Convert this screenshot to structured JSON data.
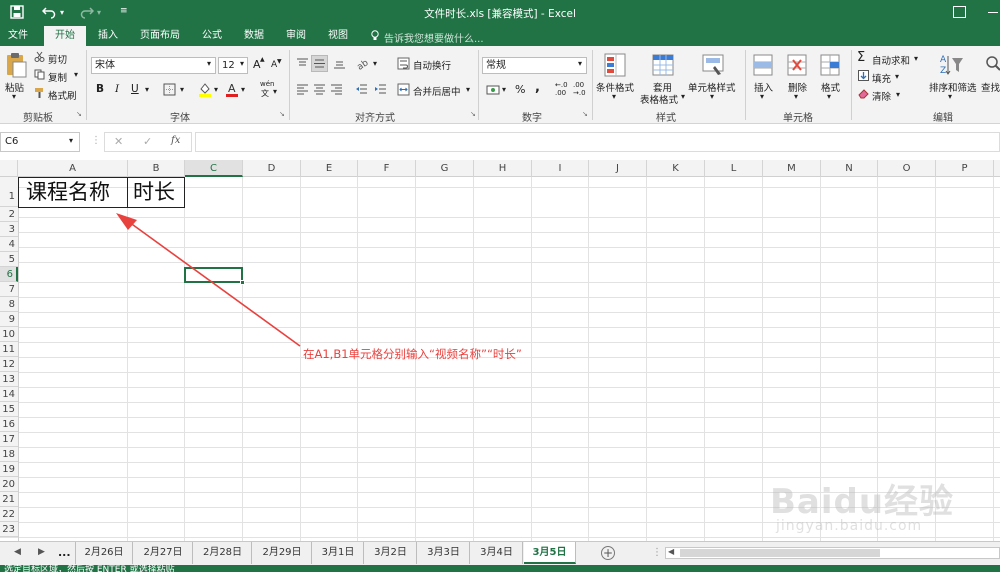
{
  "window": {
    "title": "文件时长.xls  [兼容模式] - Excel"
  },
  "tabs": [
    {
      "label": "文件"
    },
    {
      "label": "开始"
    },
    {
      "label": "插入"
    },
    {
      "label": "页面布局"
    },
    {
      "label": "公式"
    },
    {
      "label": "数据"
    },
    {
      "label": "审阅"
    },
    {
      "label": "视图"
    }
  ],
  "tell_me": "告诉我您想要做什么...",
  "ribbon": {
    "paste": "粘贴",
    "cut": "剪切",
    "copy": "复制",
    "format_painter": "格式刷",
    "clipboard_group": "剪贴板",
    "font_name": "宋体",
    "font_size": "12",
    "bold": "B",
    "italic": "I",
    "underline": "U",
    "font_group": "字体",
    "wrap_text": "自动换行",
    "merge_center": "合并后居中",
    "alignment_group": "对齐方式",
    "number_format": "常规",
    "percent": "%",
    "comma": ",",
    "number_group": "数字",
    "conditional_format": "条件格式",
    "table_format_1": "套用",
    "table_format_2": "表格格式",
    "cell_style": "单元格样式",
    "styles_group": "样式",
    "insert": "插入",
    "delete": "删除",
    "format": "格式",
    "cells_group": "单元格",
    "autosum": "自动求和",
    "fill": "填充",
    "clear": "清除",
    "sort_filter": "排序和筛选",
    "find": "查找",
    "editing_group": "编辑",
    "font_grow": "A",
    "font_shrink": "A",
    "wen": "wén"
  },
  "formula_bar": {
    "name_box": "C6",
    "fx": "fx",
    "formula": ""
  },
  "columns": [
    "A",
    "B",
    "C",
    "D",
    "E",
    "F",
    "G",
    "H",
    "I",
    "J",
    "K",
    "L",
    "M",
    "N",
    "O",
    "P"
  ],
  "rows": [
    "1",
    "2",
    "3",
    "4",
    "5",
    "6",
    "7",
    "8",
    "9",
    "10",
    "11",
    "12",
    "13",
    "14",
    "15",
    "16",
    "17",
    "18",
    "19",
    "20",
    "21",
    "22",
    "23"
  ],
  "cells": {
    "A1": "课程名称",
    "B1": "时长"
  },
  "annotation": {
    "text": "在A1,B1单元格分别输入“视频名称”“时长”",
    "color": "#e8423f"
  },
  "sheet_tabs": [
    {
      "label": "2月26日"
    },
    {
      "label": "2月27日"
    },
    {
      "label": "2月28日"
    },
    {
      "label": "2月29日"
    },
    {
      "label": "3月1日"
    },
    {
      "label": "3月2日"
    },
    {
      "label": "3月3日"
    },
    {
      "label": "3月4日"
    },
    {
      "label": "3月5日"
    }
  ],
  "sheet_nav_more": "...",
  "watermark": {
    "brand": "Baidu经验",
    "url": "jingyan.baidu.com"
  },
  "status_text": "选定目标区域，然后按 ENTER 或选择粘贴",
  "colors": {
    "accent": "#217346",
    "selection": "#217346",
    "annotation": "#e8423f"
  }
}
